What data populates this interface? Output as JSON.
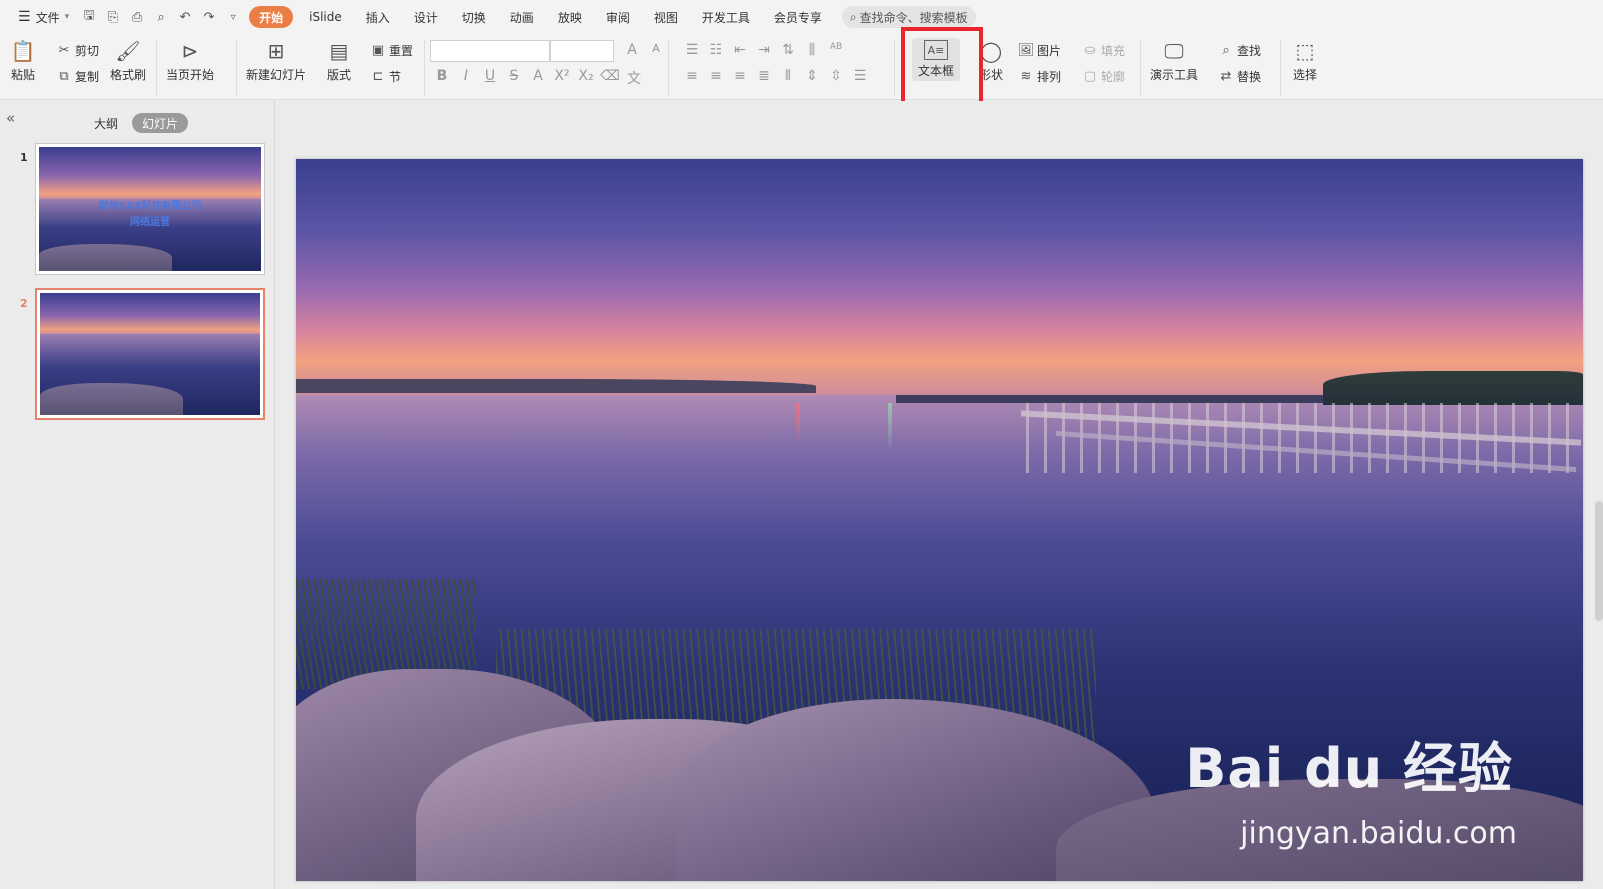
{
  "menubar": {
    "file_label": "文件",
    "tabs": [
      "开始",
      "iSlide",
      "插入",
      "设计",
      "切换",
      "动画",
      "放映",
      "审阅",
      "视图",
      "开发工具",
      "会员专享"
    ],
    "search_placeholder": "查找命令、搜索模板"
  },
  "ribbon": {
    "paste": "粘贴",
    "cut": "剪切",
    "copy": "复制",
    "format_painter": "格式刷",
    "from_current": "当页开始",
    "new_slide": "新建幻灯片",
    "layout": "版式",
    "reset": "重置",
    "section": "节",
    "textbox": "文本框",
    "shape": "形状",
    "picture": "图片",
    "fill": "填充",
    "arrange": "排列",
    "outline": "轮廓",
    "presentation_tools": "演示工具",
    "find": "查找",
    "replace": "替换",
    "select": "选择"
  },
  "sidebar": {
    "tab_outline": "大纲",
    "tab_slides": "幻灯片",
    "slides": [
      {
        "number": "1",
        "title": "郑州XXX科技有限公司",
        "subtitle": "网络运营"
      },
      {
        "number": "2"
      }
    ]
  },
  "watermark": {
    "brand": "Bai du 经验",
    "url": "jingyan.baidu.com"
  },
  "colors": {
    "accent": "#ea7e45",
    "highlight": "#e8262b",
    "selected_thumb": "#e8836b"
  }
}
